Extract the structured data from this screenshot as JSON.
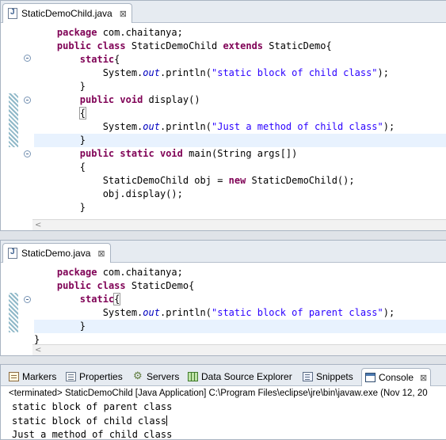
{
  "editor1": {
    "tab_title": "StaticDemoChild.java",
    "close_glyph": "⊠",
    "lines": [
      [
        "    ",
        {
          "t": "package",
          "c": "kw"
        },
        " com.chaitanya;"
      ],
      [
        "    ",
        {
          "t": "public",
          "c": "kw"
        },
        " ",
        {
          "t": "class",
          "c": "kw"
        },
        " StaticDemoChild ",
        {
          "t": "extends",
          "c": "kw"
        },
        " StaticDemo{"
      ],
      [
        "        ",
        {
          "t": "static",
          "c": "kw"
        },
        "{"
      ],
      [
        "            System.",
        {
          "t": "out",
          "c": "fld"
        },
        ".println(",
        {
          "t": "\"static block of child class\"",
          "c": "str"
        },
        ");"
      ],
      [
        "        }"
      ],
      [
        "        ",
        {
          "t": "public",
          "c": "kw"
        },
        " ",
        {
          "t": "void",
          "c": "kw"
        },
        " display()"
      ],
      [
        "        ",
        {
          "t": "{",
          "c": "box"
        }
      ],
      [
        "            System.",
        {
          "t": "out",
          "c": "fld"
        },
        ".println(",
        {
          "t": "\"Just a method of child class\"",
          "c": "str"
        },
        ");"
      ],
      [
        "        }"
      ],
      [
        "        ",
        {
          "t": "public",
          "c": "kw"
        },
        " ",
        {
          "t": "static",
          "c": "kw"
        },
        " ",
        {
          "t": "void",
          "c": "kw"
        },
        " main(String args[])"
      ],
      [
        "        {"
      ],
      [
        "            StaticDemoChild obj = ",
        {
          "t": "new",
          "c": "kw"
        },
        " StaticDemoChild();"
      ],
      [
        "            obj.display();"
      ],
      [
        "        }"
      ]
    ],
    "highlight_line": 8
  },
  "editor2": {
    "tab_title": "StaticDemo.java",
    "close_glyph": "⊠",
    "lines": [
      [
        "    ",
        {
          "t": "package",
          "c": "kw"
        },
        " com.chaitanya;"
      ],
      [
        "    ",
        {
          "t": "public",
          "c": "kw"
        },
        " ",
        {
          "t": "class",
          "c": "kw"
        },
        " StaticDemo{"
      ],
      [
        "        ",
        {
          "t": "static",
          "c": "kw"
        },
        {
          "t": "{",
          "c": "box"
        }
      ],
      [
        "            System.",
        {
          "t": "out",
          "c": "fld"
        },
        ".println(",
        {
          "t": "\"static block of parent class\"",
          "c": "str"
        },
        ");"
      ],
      [
        "        }"
      ],
      [
        "}"
      ]
    ],
    "highlight_line": 4
  },
  "views": {
    "tabs": [
      {
        "label": "Markers",
        "icon": "markers-icon"
      },
      {
        "label": "Properties",
        "icon": "properties-icon"
      },
      {
        "label": "Servers",
        "icon": "servers-icon"
      },
      {
        "label": "Data Source Explorer",
        "icon": "data-source-explorer-icon"
      },
      {
        "label": "Snippets",
        "icon": "snippets-icon"
      },
      {
        "label": "Console",
        "icon": "console-icon"
      }
    ],
    "active_tab": "Console",
    "close_glyph": "⊠"
  },
  "console": {
    "status": "<terminated> StaticDemoChild [Java Application] C:\\Program Files\\eclipse\\jre\\bin\\javaw.exe (Nov 12, 20",
    "output": [
      "static block of parent class",
      "static block of child class",
      "Just a method of child class"
    ]
  }
}
